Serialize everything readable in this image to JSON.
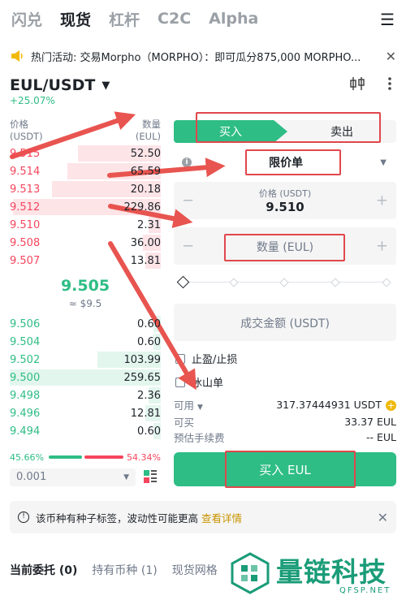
{
  "nav": {
    "tabs": [
      "闪兑",
      "现货",
      "杠杆",
      "C2C",
      "Alpha"
    ],
    "active": "现货",
    "menu_icon": "menu-icon"
  },
  "banner": {
    "text": "热门活动: 交易Morpho（MORPHO）：即可瓜分875,000 MORPHO...",
    "close": "✕"
  },
  "pair": {
    "name": "EUL/USDT",
    "change": "+25.07%"
  },
  "orderbook": {
    "price_label": "价格",
    "price_unit": "(USDT)",
    "qty_label": "数量",
    "qty_unit": "(EUL)",
    "asks": [
      {
        "price": "9.515",
        "qty": "52.50",
        "depth": 0.55
      },
      {
        "price": "9.514",
        "qty": "65.59",
        "depth": 0.62
      },
      {
        "price": "9.513",
        "qty": "20.18",
        "depth": 0.72
      },
      {
        "price": "9.512",
        "qty": "229.86",
        "depth": 0.98
      },
      {
        "price": "9.510",
        "qty": "2.31",
        "depth": 0.08
      },
      {
        "price": "9.508",
        "qty": "36.00",
        "depth": 0.12
      },
      {
        "price": "9.507",
        "qty": "13.81",
        "depth": 0.1
      }
    ],
    "mid_price": "9.505",
    "mid_usd": "≈ $9.5",
    "bids": [
      {
        "price": "9.506",
        "qty": "0.60",
        "depth": 0.05
      },
      {
        "price": "9.504",
        "qty": "0.60",
        "depth": 0.05
      },
      {
        "price": "9.502",
        "qty": "103.99",
        "depth": 0.42
      },
      {
        "price": "9.500",
        "qty": "259.65",
        "depth": 1.0
      },
      {
        "price": "9.498",
        "qty": "2.36",
        "depth": 0.08
      },
      {
        "price": "9.496",
        "qty": "12.81",
        "depth": 0.1
      },
      {
        "price": "9.494",
        "qty": "0.60",
        "depth": 0.05
      }
    ],
    "buy_ratio": "45.66%",
    "sell_ratio": "54.34%",
    "buy_ratio_value": 0.4566,
    "precision": "0.001"
  },
  "form": {
    "buy_tab": "买入",
    "sell_tab": "卖出",
    "order_type": "限价单",
    "price_label": "价格 (USDT)",
    "price_value": "9.510",
    "qty_placeholder": "数量 (EUL)",
    "amount_placeholder": "成交金额 (USDT)",
    "tp_sl": "止盈/止损",
    "iceberg": "冰山单",
    "available_label": "可用",
    "available_value": "317.37444931 USDT",
    "can_buy_label": "可买",
    "can_buy_value": "33.37 EUL",
    "fee_label": "预估手续费",
    "fee_value": "-- EUL",
    "buy_button": "买入 EUL",
    "minus": "−",
    "plus": "+"
  },
  "notice": {
    "text": "该币种有种子标签，波动性可能更高",
    "link": "查看详情",
    "close": "✕"
  },
  "bottom_tabs": [
    "当前委托 (0)",
    "持有币种 (1)",
    "现货网格"
  ],
  "watermark": {
    "name": "量链科技",
    "site": "QFSP.NET"
  },
  "colors": {
    "green": "#2ebd85",
    "red": "#f6465d",
    "annotation_red": "#e0474c"
  }
}
